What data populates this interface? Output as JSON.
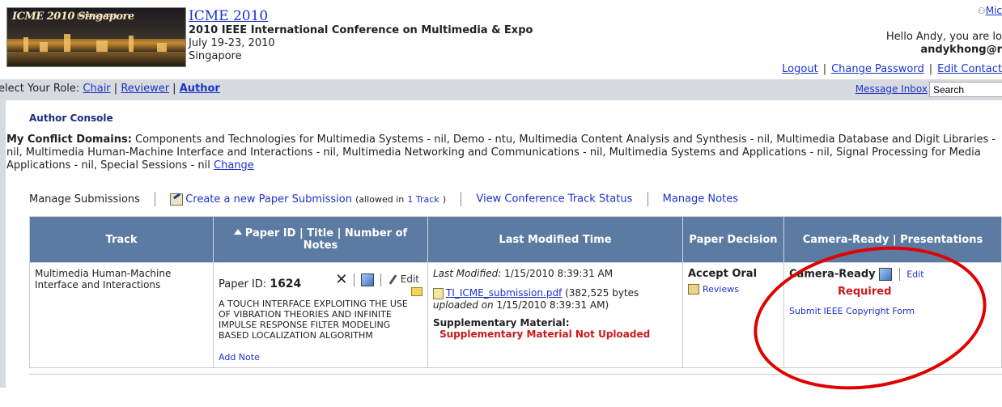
{
  "conference": {
    "short_name": "ICME 2010",
    "full_name": "2010 IEEE International Conference on Multimedia & Expo",
    "dates": "July 19-23, 2010",
    "location": "Singapore",
    "banner_text": "ICME 2010 Singapore",
    "banner_subtext": "July 19-23, 2010"
  },
  "user": {
    "top_link": "Mic",
    "greeting": "Hello Andy, you are lo",
    "email": "andykhong@r"
  },
  "account_links": {
    "logout": "Logout",
    "change_password": "Change Password",
    "edit_contact": "Edit Contact"
  },
  "role_bar": {
    "prefix": "elect Your Role:",
    "chair": "Chair",
    "reviewer": "Reviewer",
    "author": "Author",
    "message_inbox": "Message Inbox",
    "search_placeholder": "Search"
  },
  "console": {
    "title": "Author Console",
    "conflict_label": "My Conflict Domains:",
    "conflict_text": " Components and Technologies for Multimedia Systems - nil, Demo - ntu, Multimedia Content Analysis and Synthesis - nil, Multimedia Database and Digit Libraries - nil, Multimedia Human-Machine Interface and Interactions - nil, Multimedia Networking and Communications - nil, Multimedia Systems and Applications - nil, Signal Processing for Media Applications - nil, Special Sessions - nil",
    "change_link": "Change"
  },
  "manage_bar": {
    "manage_submissions": "Manage Submissions",
    "create_new": "Create a new Paper Submission",
    "allowed_prefix": "(allowed in",
    "allowed_link": "1 Track",
    "allowed_suffix": ")",
    "view_track_status": "View Conference Track Status",
    "manage_notes": "Manage Notes"
  },
  "table": {
    "headers": {
      "track": "Track",
      "paper_id": "Paper ID",
      "title": "Title",
      "number_of_notes": "Number of Notes",
      "last_modified": "Last Modified Time",
      "decision": "Paper Decision",
      "camera_ready": "Camera-Ready | Presentations"
    },
    "rows": [
      {
        "track": "Multimedia Human-Machine Interface and Interactions",
        "paper_id_label": "Paper ID:",
        "paper_id": "1624",
        "edit_label": "Edit",
        "title": "A TOUCH INTERFACE EXPLOITING THE USE OF VIBRATION THEORIES AND INFINITE IMPULSE RESPONSE FILTER MODELING BASED LOCALIZATION ALGORITHM",
        "add_note": "Add Note",
        "last_modified_label": "Last Modified:",
        "last_modified": "1/15/2010 8:39:31 AM",
        "file_name": "TI_ICME_submission.pdf",
        "file_size": "(382,525 bytes",
        "uploaded_label": "uploaded on",
        "uploaded_on": "1/15/2010 8:39:31 AM)",
        "supplementary_label": "Supplementary Material:",
        "supplementary_status": "Supplementary Material Not Uploaded",
        "decision": "Accept Oral",
        "reviews": "Reviews",
        "camera_ready_label": "Camera-Ready",
        "camera_ready_edit": "Edit",
        "camera_ready_status": "Required",
        "copyright_link": "Submit IEEE Copyright Form"
      }
    ]
  },
  "colors": {
    "header_blue": "#5b7ba3",
    "link_blue": "#1a33c8",
    "required_red": "#cc1a1a",
    "annotation_circle": "#e00000"
  }
}
